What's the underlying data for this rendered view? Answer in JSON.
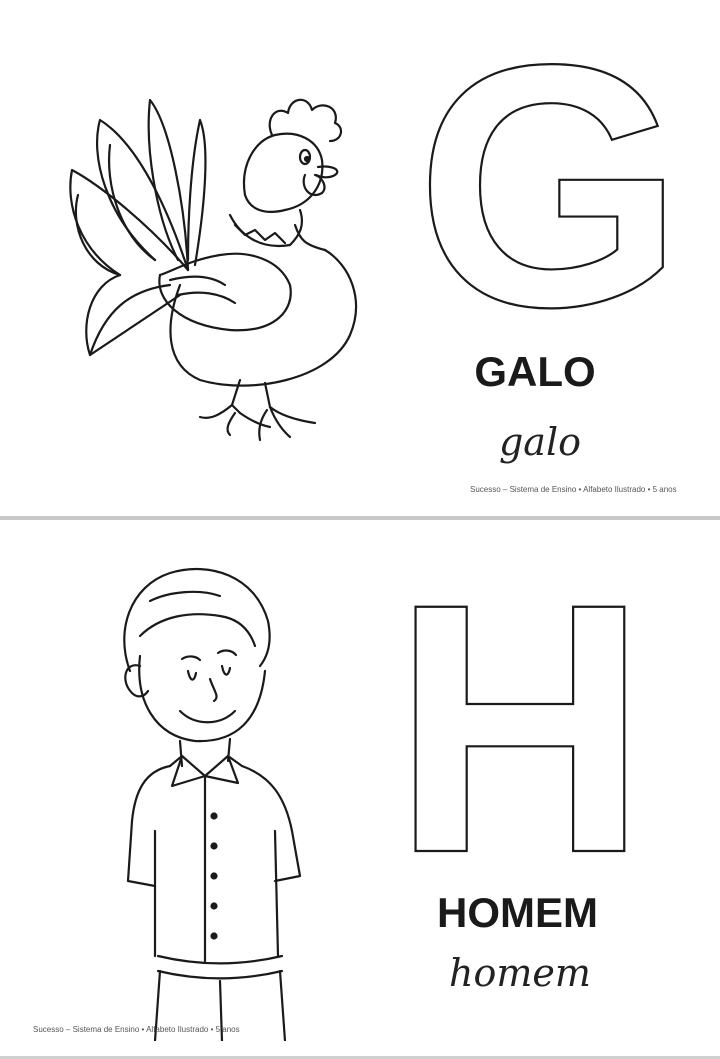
{
  "pages": [
    {
      "letter": "G",
      "word_print": "GALO",
      "word_cursive": "galo",
      "illustration": "rooster-icon",
      "footer": "Sucesso – Sistema de Ensino • Alfabeto Ilustrado • 5 anos"
    },
    {
      "letter": "H",
      "word_print": "HOMEM",
      "word_cursive": "homem",
      "illustration": "man-icon",
      "footer": "Sucesso – Sistema de Ensino • Alfabeto Ilustrado • 5 anos"
    }
  ],
  "colors": {
    "ink": "#1a1a1a",
    "divider": "#c9c9c9",
    "background": "#ffffff"
  }
}
